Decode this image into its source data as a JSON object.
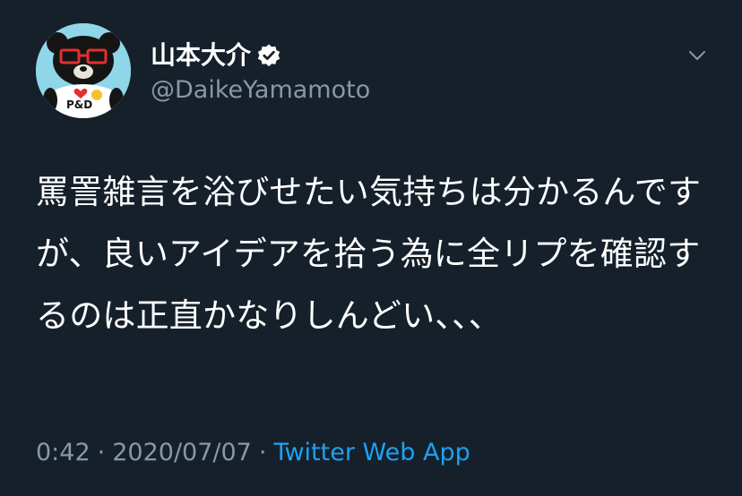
{
  "tweet": {
    "author": {
      "display_name": "山本大介",
      "handle": "@DaikeYamamoto",
      "verified": true,
      "avatar_icon": "bear-avatar-icon",
      "avatar_shirt_text": "P&D"
    },
    "text": "罵詈雑言を浴びせたい気持ちは分かるんですが、良いアイデアを拾う為に全リプを確認するのは正直かなりしんどい、、、",
    "time": "0:42",
    "date": "2020/07/07",
    "separator": "·",
    "source": "Twitter Web App",
    "menu_icon": "chevron-down-icon"
  },
  "colors": {
    "background": "#15202b",
    "text": "#ffffff",
    "secondary": "#8899a6",
    "link": "#1da1f2"
  }
}
